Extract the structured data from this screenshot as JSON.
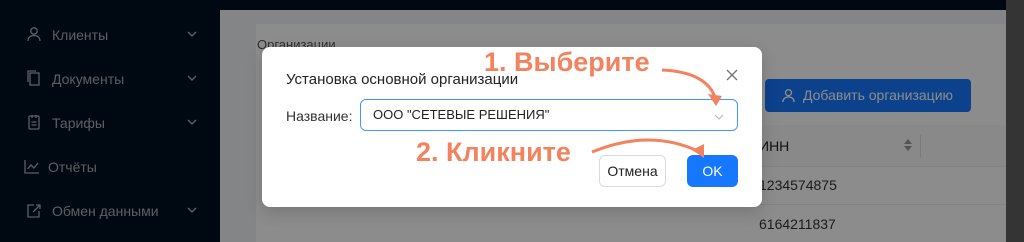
{
  "sidebar": {
    "items": [
      {
        "label": "Клиенты",
        "icon": "user-icon",
        "has_submenu": true
      },
      {
        "label": "Документы",
        "icon": "documents-icon",
        "has_submenu": true
      },
      {
        "label": "Тарифы",
        "icon": "tariff-icon",
        "has_submenu": true
      },
      {
        "label": "Отчёты",
        "icon": "chart-icon",
        "has_submenu": false
      },
      {
        "label": "Обмен данными",
        "icon": "exchange-icon",
        "has_submenu": true
      }
    ]
  },
  "page": {
    "breadcrumb": "Организации",
    "add_button_label": "Добавить организацию",
    "table": {
      "column_inn": "ИНН",
      "rows": [
        "1234574875",
        "6164211837"
      ]
    }
  },
  "modal": {
    "title": "Установка основной организации",
    "field_label": "Название",
    "selected_value": "ООО \"СЕТЕВЫЕ РЕШЕНИЯ\"",
    "cancel_label": "Отмена",
    "ok_label": "OK"
  },
  "annotations": {
    "step1": "1. Выберите",
    "step2": "2. Кликните"
  },
  "colors": {
    "accent": "#1677ff",
    "annotation": "#f2835e",
    "sidebar_bg": "#011222"
  }
}
